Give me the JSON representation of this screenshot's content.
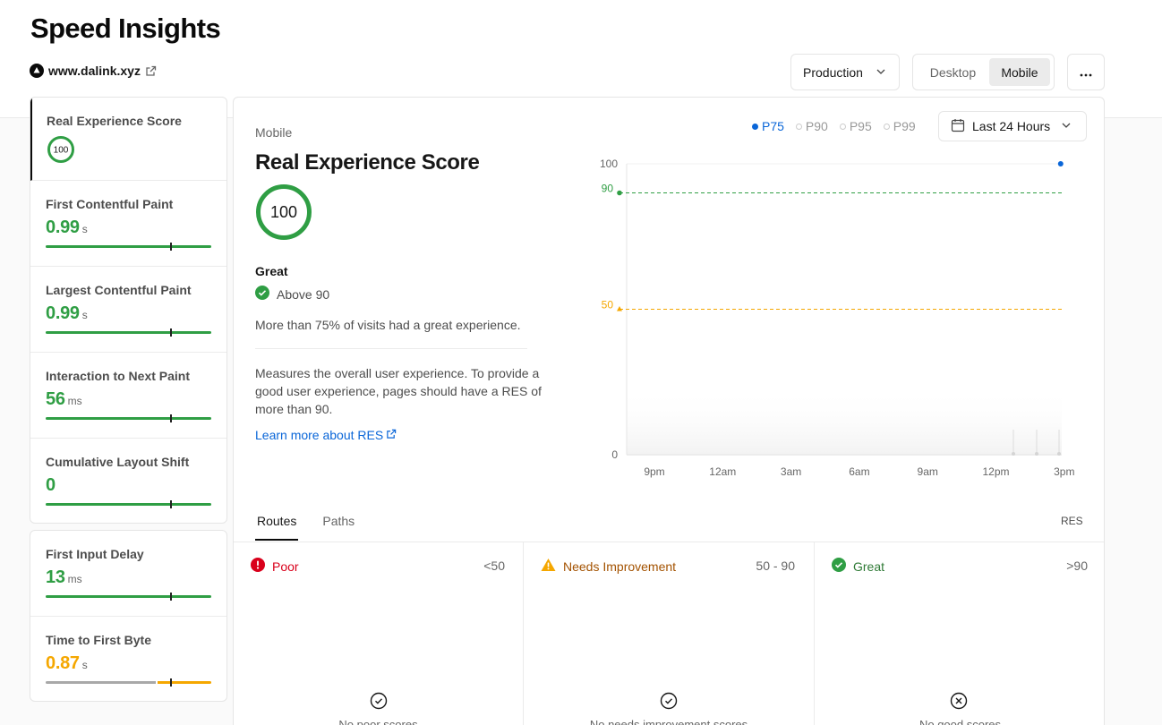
{
  "page": {
    "title": "Speed Insights"
  },
  "domain": {
    "label": "www.dalink.xyz",
    "vercel_icon": "triangle-logo-icon",
    "link_icon": "external-link-icon"
  },
  "toolbar": {
    "environment": "Production",
    "devices": [
      "Desktop",
      "Mobile"
    ],
    "selected_device": "Mobile",
    "more_icon": "ellipsis-icon"
  },
  "metrics_primary": [
    {
      "label": "Real Experience Score",
      "value": "100",
      "unit": "",
      "kind": "ring",
      "active": true,
      "score": 100
    },
    {
      "label": "First Contentful Paint",
      "value": "0.99",
      "unit": "s",
      "status": "good",
      "bar_marker": 0.75
    },
    {
      "label": "Largest Contentful Paint",
      "value": "0.99",
      "unit": "s",
      "status": "good",
      "bar_marker": 0.75
    },
    {
      "label": "Interaction to Next Paint",
      "value": "56",
      "unit": "ms",
      "status": "good",
      "bar_marker": 0.75
    },
    {
      "label": "Cumulative Layout Shift",
      "value": "0",
      "unit": "",
      "status": "good",
      "bar_marker": 0.75
    }
  ],
  "metrics_secondary": [
    {
      "label": "First Input Delay",
      "value": "13",
      "unit": "ms",
      "status": "good",
      "bar_marker": 0.75
    },
    {
      "label": "Time to First Byte",
      "value": "0.87",
      "unit": "s",
      "status": "warn",
      "bar_marker": 0.75
    }
  ],
  "detail": {
    "subtitle": "Mobile",
    "title": "Real Experience Score",
    "score": "100",
    "grade": "Great",
    "threshold": "Above 90",
    "visits_text": "More than 75% of visits had a great experience.",
    "description": "Measures the overall user experience. To provide a good user experience, pages should have a RES of more than 90.",
    "learn_more": "Learn more about RES"
  },
  "percentiles": {
    "options": [
      "P75",
      "P90",
      "P95",
      "P99"
    ],
    "selected": "P75"
  },
  "time_range": {
    "label": "Last 24 Hours",
    "icon": "calendar-icon"
  },
  "chart_data": {
    "type": "line",
    "x_ticks": [
      "9pm",
      "12am",
      "3am",
      "6am",
      "9am",
      "12pm",
      "3pm"
    ],
    "y_ticks": [
      "0",
      "100"
    ],
    "ylim": [
      0,
      100
    ],
    "thresholds": [
      {
        "label": "90",
        "value": 90,
        "color": "#2f9e44"
      },
      {
        "label": "50",
        "value": 50,
        "color": "#f5a700"
      }
    ],
    "series": [
      {
        "values": [
          {
            "x": "3pm",
            "y": 100
          }
        ],
        "color": "#0a66d8"
      }
    ],
    "grid": false
  },
  "tabs": {
    "items": [
      "Routes",
      "Paths"
    ],
    "selected": "Routes",
    "right_label": "RES"
  },
  "buckets": [
    {
      "name": "Poor",
      "range": "<50",
      "empty": "No poor scores",
      "icon": "alert-circle-icon",
      "empty_icon": "check-circle-icon",
      "color": "#d9001b"
    },
    {
      "name": "Needs Improvement",
      "range": "50 - 90",
      "empty": "No needs improvement scores",
      "icon": "warning-triangle-icon",
      "empty_icon": "check-circle-icon",
      "color": "#f5a700"
    },
    {
      "name": "Great",
      "range": ">90",
      "empty": "No good scores",
      "icon": "check-circle-filled-icon",
      "empty_icon": "x-circle-icon",
      "color": "#2f9e44"
    }
  ]
}
